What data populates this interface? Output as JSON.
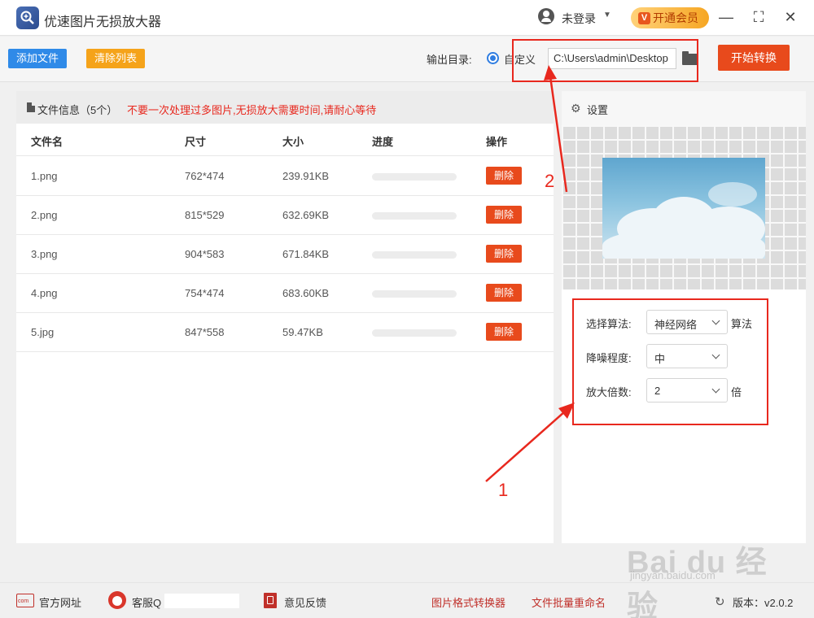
{
  "titlebar": {
    "app_title": "优速图片无损放大器",
    "login_label": "未登录",
    "vip_badge": "V",
    "vip_label": "开通会员",
    "minimize": "—",
    "maximize": "⛶",
    "close": "✕"
  },
  "toolbar": {
    "add_file_label": "添加文件",
    "clear_list_label": "清除列表",
    "output_dir_label": "输出目录:",
    "custom_option_label": "自定义",
    "output_path_value": "C:\\Users\\admin\\Desktop",
    "start_label": "开始转换"
  },
  "file_panel": {
    "info_label": "文件信息（5个）",
    "warning_text": "不要一次处理过多图片,无损放大需要时间,请耐心等待",
    "columns": {
      "name": "文件名",
      "size": "尺寸",
      "filesize": "大小",
      "progress": "进度",
      "action": "操作"
    },
    "rows": [
      {
        "name": "1.png",
        "size": "762*474",
        "filesize": "239.91KB",
        "progress": 0,
        "action": "删除"
      },
      {
        "name": "2.png",
        "size": "815*529",
        "filesize": "632.69KB",
        "progress": 0,
        "action": "删除"
      },
      {
        "name": "3.png",
        "size": "904*583",
        "filesize": "671.84KB",
        "progress": 0,
        "action": "删除"
      },
      {
        "name": "4.png",
        "size": "754*474",
        "filesize": "683.60KB",
        "progress": 0,
        "action": "删除"
      },
      {
        "name": "5.jpg",
        "size": "847*558",
        "filesize": "59.47KB",
        "progress": 0,
        "action": "删除"
      }
    ]
  },
  "settings": {
    "title": "设置",
    "algorithm_label": "选择算法:",
    "algorithm_value": "神经网络",
    "algorithm_suffix": "算法",
    "denoise_label": "降噪程度:",
    "denoise_value": "中",
    "scale_label": "放大倍数:",
    "scale_value": "2",
    "scale_suffix": "倍"
  },
  "annotations": {
    "marker_1": "1",
    "marker_2": "2",
    "color": "#e8281e"
  },
  "footer": {
    "website_label": "官方网址",
    "website_icon_text": "com",
    "service_label": "客服Q",
    "feedback_label": "意见反馈",
    "converter_label": "图片格式转换器",
    "rename_label": "文件批量重命名",
    "version_label": "版本：v2.0.2"
  },
  "watermark": {
    "brand": "Bai du 经验",
    "url": "jingyan.baidu.com"
  },
  "colors": {
    "primary_blue": "#2f8ae8",
    "orange": "#f5a31a",
    "start_red": "#e84a1c",
    "warning_red": "#e8281e"
  }
}
